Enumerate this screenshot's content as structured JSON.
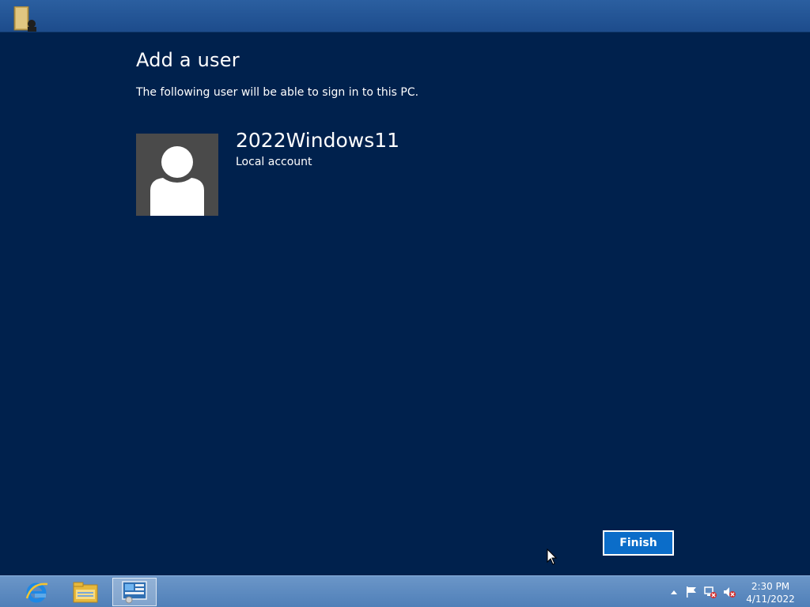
{
  "window": {
    "app_icon": "user-accounts-icon"
  },
  "content": {
    "title": "Add a user",
    "subtitle": "The following user will be able to sign in to this PC.",
    "user": {
      "name": "2022Windows11",
      "account_type": "Local account",
      "avatar_icon": "user-silhouette-icon"
    },
    "finish_label": "Finish"
  },
  "taskbar": {
    "pinned": [
      {
        "name": "internet-explorer",
        "icon": "internet-explorer-icon",
        "active": false
      },
      {
        "name": "file-explorer",
        "icon": "folder-icon",
        "active": false
      },
      {
        "name": "control-panel",
        "icon": "control-panel-icon",
        "active": true
      }
    ],
    "tray": {
      "icons": [
        "show-hidden-icons-arrow",
        "action-center-flag-icon",
        "network-disconnected-icon",
        "volume-muted-icon"
      ],
      "time": "2:30 PM",
      "date": "4/11/2022"
    }
  },
  "colors": {
    "background": "#00214d",
    "accent_button": "#0b6dc9",
    "avatar_bg": "#4a4a4a"
  }
}
